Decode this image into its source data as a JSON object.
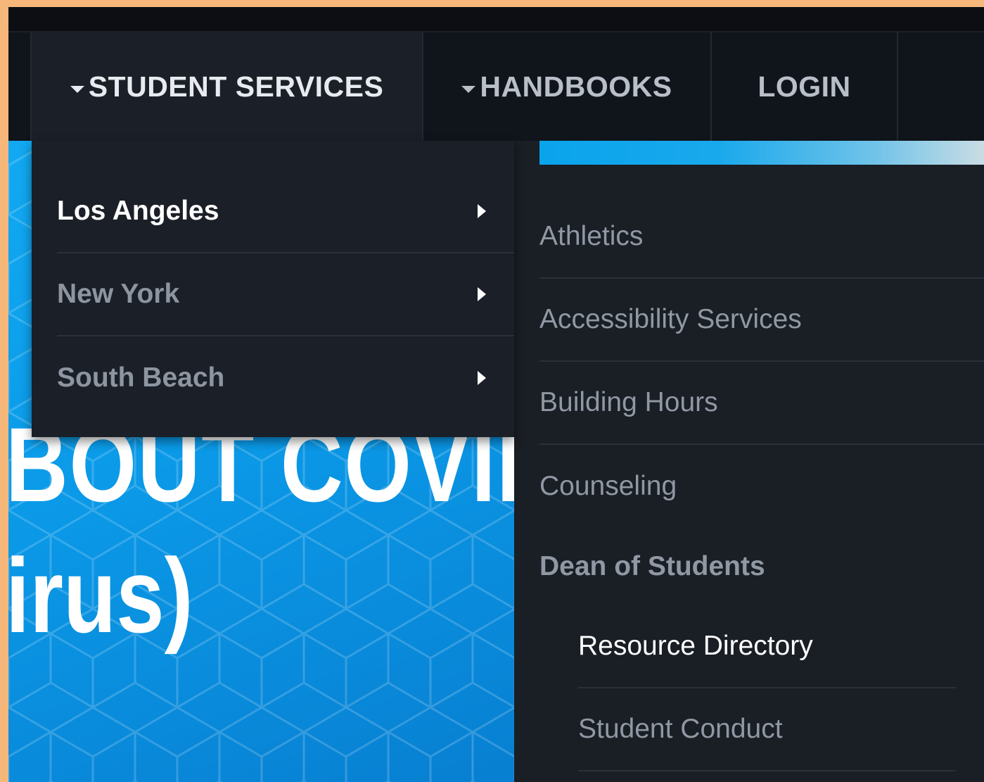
{
  "nav": {
    "student_services": "STUDENT SERVICES",
    "handbooks": "HANDBOOKS",
    "login": "LOGIN"
  },
  "dropdown": {
    "items": [
      {
        "label": "Los Angeles"
      },
      {
        "label": "New York"
      },
      {
        "label": "South Beach"
      }
    ]
  },
  "submenu": {
    "items": [
      {
        "label": "Athletics"
      },
      {
        "label": "Accessibility Services"
      },
      {
        "label": "Building Hours"
      },
      {
        "label": "Counseling"
      },
      {
        "label": "Dean of Students"
      }
    ],
    "dean_children": [
      {
        "label": "Resource Directory"
      },
      {
        "label": "Student Conduct"
      }
    ]
  },
  "hero": {
    "line1": "BOUT COVID",
    "line2": "irus)"
  },
  "colors": {
    "page_border": "#f6b77b",
    "nav_bg": "#10141b",
    "menu_bg": "#1b1f27",
    "hero_blue": "#0b9ae8",
    "accent_gradient_start": "#0aa4ec"
  },
  "icons": [
    "chevron-down-icon",
    "chevron-right-icon"
  ]
}
